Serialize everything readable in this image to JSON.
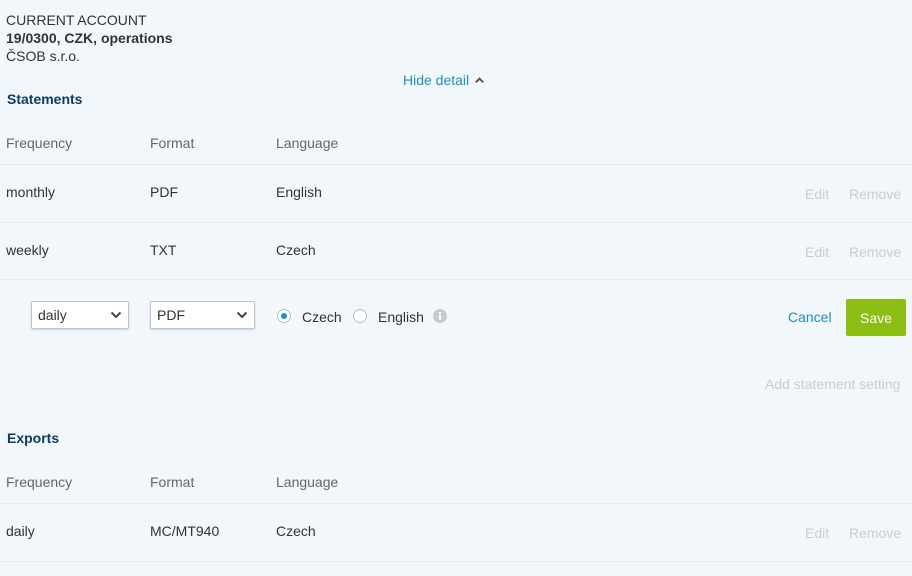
{
  "account": {
    "type": "CURRENT ACCOUNT",
    "number": "19/0300, CZK, operations",
    "owner": "ČSOB s.r.o."
  },
  "hide_detail": {
    "label": "Hide detail",
    "icon": "chevron-up-icon"
  },
  "statements": {
    "title": "Statements",
    "headers": {
      "frequency": "Frequency",
      "format": "Format",
      "language": "Language"
    },
    "rows": [
      {
        "frequency": "monthly",
        "format": "PDF",
        "language": "English",
        "edit": "Edit",
        "remove": "Remove"
      },
      {
        "frequency": "weekly",
        "format": "TXT",
        "language": "Czech",
        "edit": "Edit",
        "remove": "Remove"
      }
    ],
    "editor": {
      "frequency_value": "daily",
      "format_value": "PDF",
      "language_options": [
        {
          "label": "Czech",
          "selected": true
        },
        {
          "label": "English",
          "selected": false
        }
      ],
      "info_icon": "info-icon",
      "cancel_label": "Cancel",
      "save_label": "Save"
    },
    "add_label": "Add statement setting"
  },
  "exports": {
    "title": "Exports",
    "headers": {
      "frequency": "Frequency",
      "format": "Format",
      "language": "Language"
    },
    "rows": [
      {
        "frequency": "daily",
        "format": "MC/MT940",
        "language": "Czech",
        "edit": "Edit",
        "remove": "Remove"
      }
    ]
  },
  "colors": {
    "background": "#f2f7fc",
    "heading": "#0c3c68",
    "link": "#1f8fc4",
    "save": "#8cbd12",
    "disabled": "#c9cdd1",
    "radio_selected": "#1a8ed6"
  }
}
